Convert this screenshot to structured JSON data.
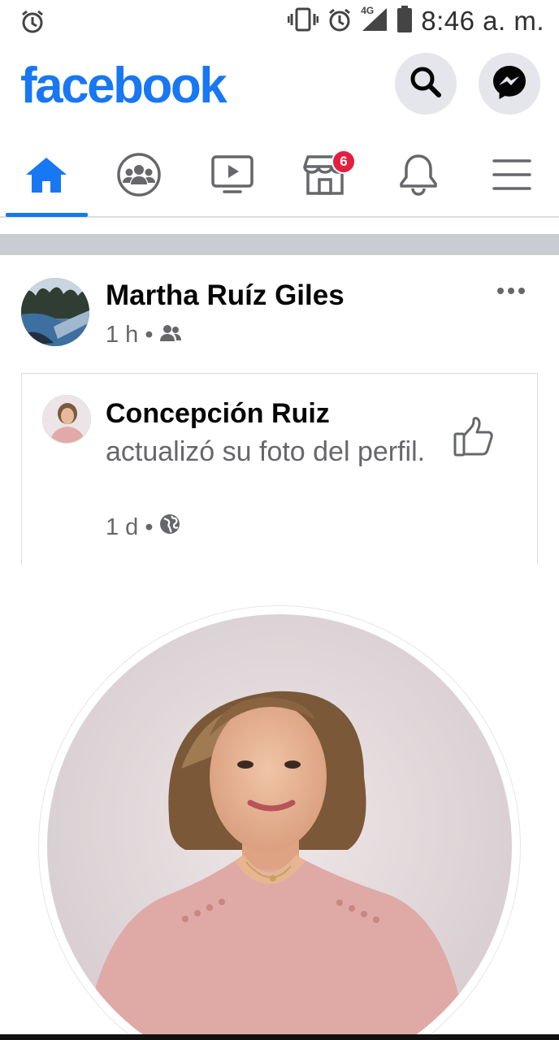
{
  "status_bar": {
    "time": "8:46 a. m.",
    "network": "4G",
    "icons": [
      "alarm-icon",
      "vibrate-icon",
      "alarm-icon",
      "signal-icon",
      "battery-icon"
    ]
  },
  "header": {
    "logo": "facebook",
    "brand_color": "#1877f2",
    "buttons": [
      "search-icon",
      "messenger-icon"
    ]
  },
  "nav": {
    "tabs": [
      {
        "name": "home",
        "icon": "home-icon",
        "active": true
      },
      {
        "name": "groups",
        "icon": "groups-icon"
      },
      {
        "name": "watch",
        "icon": "video-icon"
      },
      {
        "name": "marketplace",
        "icon": "store-icon",
        "badge": "6"
      },
      {
        "name": "notifications",
        "icon": "bell-icon"
      },
      {
        "name": "menu",
        "icon": "hamburger-icon"
      }
    ]
  },
  "post": {
    "author": "Martha Ruíz Giles",
    "time": "1 h",
    "audience_icon": "friends-icon",
    "shared": {
      "name": "Concepción Ruiz",
      "text": "actualizó su foto del perfil.",
      "time": "1 d",
      "audience_icon": "globe-icon"
    }
  }
}
